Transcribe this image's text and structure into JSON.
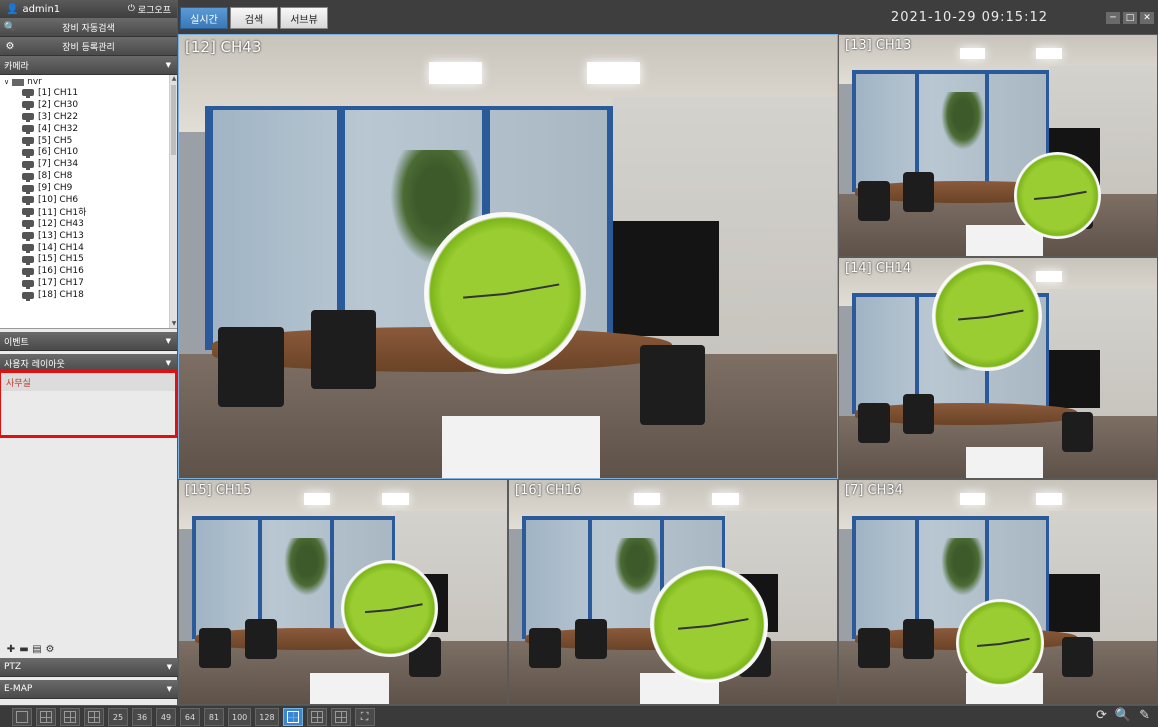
{
  "sidebar": {
    "user": "admin1",
    "logout_label": "로그오프",
    "auto_search_label": "장비 자동검색",
    "device_manage_label": "장비 등록관리",
    "camera_section": "카메라",
    "tree_root": "nvr",
    "cameras": [
      "[1] CH11",
      "[2] CH30",
      "[3] CH22",
      "[4] CH32",
      "[5] CH5",
      "[6] CH10",
      "[7] CH34",
      "[8] CH8",
      "[9] CH9",
      "[10] CH6",
      "[11] CH1하",
      "[12] CH43",
      "[13] CH13",
      "[14] CH14",
      "[15] CH15",
      "[16] CH16",
      "[17] CH17",
      "[18] CH18"
    ],
    "event_section": "이벤트",
    "user_layout_section": "사용자 레이아웃",
    "layouts": [
      "사무실"
    ],
    "ptz_section": "PTZ",
    "emap_section": "E-MAP"
  },
  "topbar": {
    "tabs": [
      "실시간",
      "검색",
      "서브뷰"
    ],
    "active_tab": 0,
    "datetime": "2021-10-29  09:15:12"
  },
  "grid": {
    "tiles": [
      {
        "label": "[12] CH43",
        "selected": true
      },
      {
        "label": "[13] CH13"
      },
      {
        "label": "[14] CH14"
      },
      {
        "label": "[15] CH15"
      },
      {
        "label": "[16] CH16"
      },
      {
        "label": "[7] CH34"
      }
    ]
  },
  "bottombar": {
    "layout_numbers": [
      "25",
      "36",
      "49",
      "64",
      "81",
      "100",
      "128"
    ]
  },
  "colors": {
    "active_tab": "#3a78b8",
    "highlight": "#e01010",
    "layout_item_text": "#c0392b"
  }
}
